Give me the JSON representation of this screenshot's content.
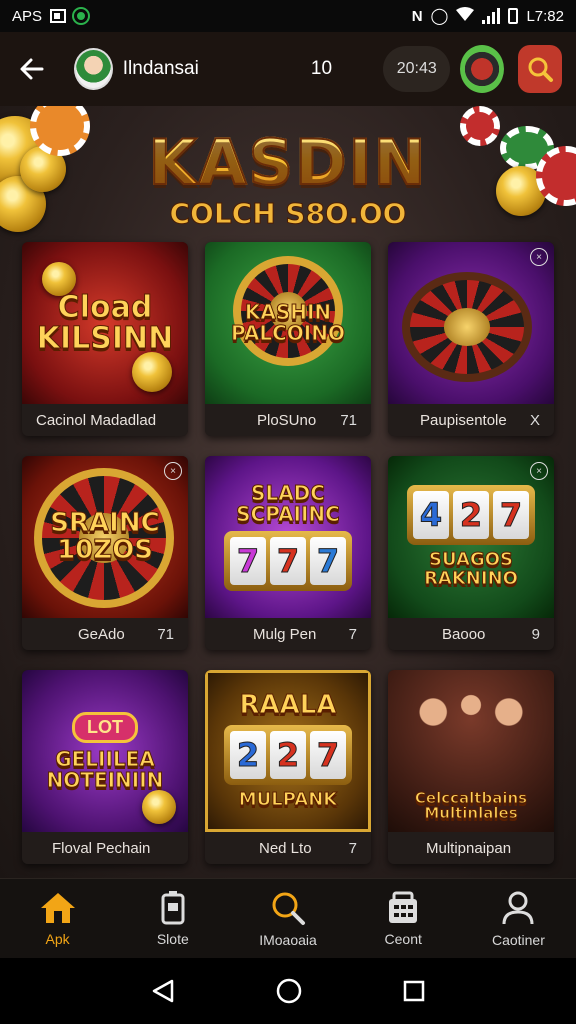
{
  "status_bar": {
    "left_text": "APS",
    "time": "L7:82"
  },
  "header": {
    "username": "Ilndansai",
    "count": "10",
    "timer": "20:43"
  },
  "banner": {
    "title": "KASDIN",
    "subtitle": "COLCH S8O.OO"
  },
  "games": [
    {
      "art_text": "Cload KILSINN",
      "label": "Cacinol Madadlad",
      "badge": ""
    },
    {
      "art_text": "KASHIN PALCOINO",
      "label": "PloSUno",
      "badge": "71"
    },
    {
      "art_text": "",
      "label": "Paupisentole",
      "badge": "X"
    },
    {
      "art_text": "SRAINC 10ZOS",
      "label": "GeAdo",
      "badge": "71"
    },
    {
      "art_text": "SLADC SCPAIINC",
      "label": "Mulg Pen",
      "badge": "7"
    },
    {
      "art_text": "SUAGOS RAKNINO",
      "label": "Baooo",
      "badge": "9"
    },
    {
      "art_text": "GELIILEA NOTEINIIN",
      "label": "Floval Pechain",
      "badge": "",
      "tag": "LOT"
    },
    {
      "art_text": "MULPANK",
      "label": "Ned Lto",
      "badge": "7",
      "tag": "RAALA"
    },
    {
      "art_text": "Celccaltbains Multinlales",
      "label": "Multipnaipan",
      "badge": ""
    }
  ],
  "reels": {
    "card5": [
      "7",
      "7",
      "7"
    ],
    "card6": [
      "4",
      "2",
      "7"
    ],
    "card8": [
      "2",
      "2",
      "7"
    ]
  },
  "bottom_nav": [
    {
      "label": "Apk",
      "icon": "home-icon",
      "active": true
    },
    {
      "label": "Slote",
      "icon": "slot-machine-icon",
      "active": false
    },
    {
      "label": "IMoaoaia",
      "icon": "search-icon",
      "active": false
    },
    {
      "label": "Ceont",
      "icon": "calculator-icon",
      "active": false
    },
    {
      "label": "Caotiner",
      "icon": "user-icon",
      "active": false
    }
  ],
  "colors": {
    "accent": "#f2a516",
    "search_button": "#c0392b",
    "header_bg": "#1c1410"
  }
}
